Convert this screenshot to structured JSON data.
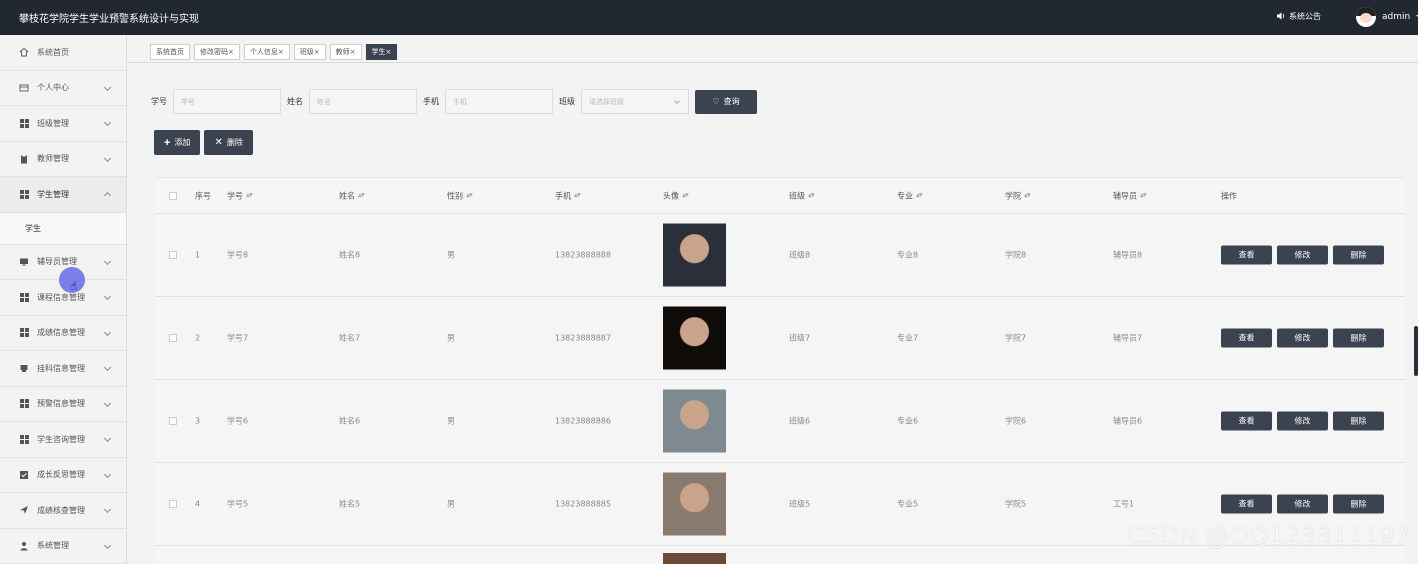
{
  "header": {
    "title": "攀枝花学院学生学业预警系统设计与实现",
    "notice_label": "系统公告",
    "user_name": "admin"
  },
  "sidebar": {
    "items": [
      {
        "label": "系统首页",
        "icon": "home-icon",
        "arrow": false
      },
      {
        "label": "个人中心",
        "icon": "user-card-icon",
        "arrow": true
      },
      {
        "label": "班级管理",
        "icon": "grid-icon",
        "arrow": true
      },
      {
        "label": "教师管理",
        "icon": "clipboard-icon",
        "arrow": true
      },
      {
        "label": "学生管理",
        "icon": "grid-icon",
        "arrow": true,
        "expanded": true
      },
      {
        "label": "学生",
        "submenu": true
      },
      {
        "label": "辅导员管理",
        "icon": "monitor-icon",
        "arrow": true
      },
      {
        "label": "课程信息管理",
        "icon": "grid-icon",
        "arrow": true
      },
      {
        "label": "成绩信息管理",
        "icon": "grid-icon",
        "arrow": true
      },
      {
        "label": "挂科信息管理",
        "icon": "printer-icon",
        "arrow": true
      },
      {
        "label": "预警信息管理",
        "icon": "grid-icon",
        "arrow": true
      },
      {
        "label": "学生咨询管理",
        "icon": "grid-icon",
        "arrow": true
      },
      {
        "label": "成长反思管理",
        "icon": "checkbox-icon",
        "arrow": true
      },
      {
        "label": "成绩核查管理",
        "icon": "send-icon",
        "arrow": true
      },
      {
        "label": "系统管理",
        "icon": "person-icon",
        "arrow": true
      }
    ]
  },
  "tabs": [
    {
      "label": "系统首页",
      "closable": false,
      "active": false
    },
    {
      "label": "修改密码",
      "closable": true,
      "active": false
    },
    {
      "label": "个人信息",
      "closable": true,
      "active": false
    },
    {
      "label": "班级",
      "closable": true,
      "active": false
    },
    {
      "label": "教师",
      "closable": true,
      "active": false
    },
    {
      "label": "学生",
      "closable": true,
      "active": true
    }
  ],
  "search": {
    "fields": [
      {
        "label": "学号",
        "placeholder": "学号"
      },
      {
        "label": "姓名",
        "placeholder": "姓名"
      },
      {
        "label": "手机",
        "placeholder": "手机"
      }
    ],
    "class_label": "班级",
    "class_placeholder": "请选择班级",
    "query_label": "查询"
  },
  "actions": {
    "add_label": "添加",
    "delete_label": "删除"
  },
  "table": {
    "columns": [
      "序号",
      "学号",
      "姓名",
      "性别",
      "手机",
      "头像",
      "班级",
      "专业",
      "学院",
      "辅导员",
      "操作"
    ],
    "rows": [
      {
        "index": "1",
        "sno": "学号8",
        "name": "姓名8",
        "gender": "男",
        "phone": "13823888888",
        "class": "班级8",
        "major": "专业8",
        "college": "学院8",
        "counselor": "辅导员8",
        "photo": "#2a2f3a"
      },
      {
        "index": "2",
        "sno": "学号7",
        "name": "姓名7",
        "gender": "男",
        "phone": "13823888887",
        "class": "班级7",
        "major": "专业7",
        "college": "学院7",
        "counselor": "辅导员7",
        "photo": "#0f0c0a"
      },
      {
        "index": "3",
        "sno": "学号6",
        "name": "姓名6",
        "gender": "男",
        "phone": "13823888886",
        "class": "班级6",
        "major": "专业6",
        "college": "学院6",
        "counselor": "辅导员6",
        "photo": "#7f8990"
      },
      {
        "index": "4",
        "sno": "学号5",
        "name": "姓名5",
        "gender": "男",
        "phone": "13823888885",
        "class": "班级5",
        "major": "专业5",
        "college": "学院5",
        "counselor": "工号1",
        "photo": "#8a7b70"
      }
    ],
    "view_label": "查看",
    "edit_label": "修改",
    "remove_label": "删除"
  },
  "watermark": "CSDN @QQ123311197"
}
